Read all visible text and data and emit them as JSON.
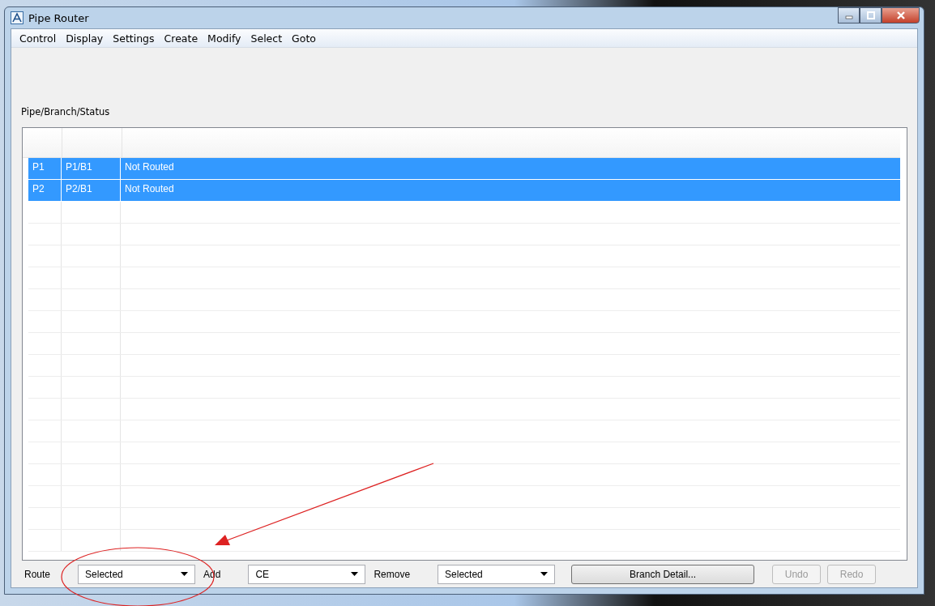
{
  "window": {
    "title": "Pipe Router"
  },
  "menu": [
    "Control",
    "Display",
    "Settings",
    "Create",
    "Modify",
    "Select",
    "Goto"
  ],
  "list_label": "Pipe/Branch/Status",
  "table": {
    "rows": [
      {
        "cells": [
          "P1",
          "P1/B1",
          "Not Routed"
        ],
        "selected": true
      },
      {
        "cells": [
          "P2",
          "P2/B1",
          "Not Routed"
        ],
        "selected": true
      }
    ]
  },
  "bottom_bar": {
    "route": {
      "label": "Route",
      "value": "Selected"
    },
    "add": {
      "label": "Add",
      "value": "CE"
    },
    "remove": {
      "label": "Remove",
      "value": "Selected"
    },
    "buttons": [
      {
        "label": "Branch Detail...",
        "disabled": false,
        "kind": "wide"
      },
      {
        "label": "Undo",
        "disabled": true,
        "kind": "small"
      },
      {
        "label": "Redo",
        "disabled": true,
        "kind": "small"
      }
    ]
  }
}
